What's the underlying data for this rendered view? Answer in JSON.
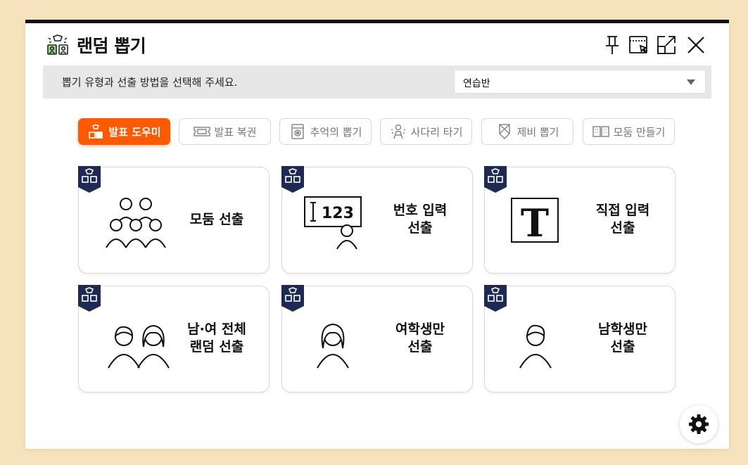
{
  "app": {
    "title": "랜덤 뽑기"
  },
  "info": {
    "text": "뽑기 유형과 선출 방법을 선택해 주세요."
  },
  "class_select": {
    "value": "연습반"
  },
  "tabs": [
    {
      "label": "발표 도우미",
      "icon": "presenter-icon",
      "active": true
    },
    {
      "label": "발표 복권",
      "icon": "ticket-icon",
      "active": false
    },
    {
      "label": "추억의 뽑기",
      "icon": "gacha-icon",
      "active": false
    },
    {
      "label": "사다리 타기",
      "icon": "ladder-person-icon",
      "active": false
    },
    {
      "label": "제비 뽑기",
      "icon": "lot-paper-icon",
      "active": false
    },
    {
      "label": "모둠 만들기",
      "icon": "group-grid-icon",
      "active": false
    }
  ],
  "cards": [
    {
      "label": "모둠 선출",
      "icon": "group-people-icon"
    },
    {
      "label": "번호 입력\n선출",
      "icon": "number-board-icon",
      "board_text": "123"
    },
    {
      "label": "직접 입력\n선출",
      "icon": "text-t-icon",
      "glyph": "T"
    },
    {
      "label": "남·여 전체\n랜덤 선출",
      "icon": "boy-girl-icon"
    },
    {
      "label": "여학생만\n선출",
      "icon": "girl-student-icon"
    },
    {
      "label": "남학생만\n선출",
      "icon": "boy-student-icon"
    }
  ],
  "colors": {
    "accent": "#ff5a00",
    "badge": "#1e2a52",
    "background": "#f6e3bd"
  }
}
